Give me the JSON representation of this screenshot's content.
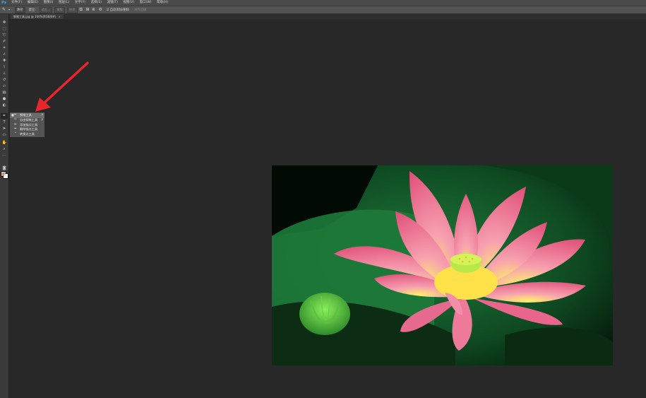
{
  "menubar": {
    "logo": "Ps",
    "items": [
      "文件(F)",
      "编辑(E)",
      "图像(I)",
      "图层(L)",
      "文字(Y)",
      "选择(S)",
      "滤镜(T)",
      "视图(V)",
      "窗口(W)",
      "帮助(H)"
    ]
  },
  "options": {
    "path_mode": "路径",
    "make_label": "建立:",
    "selection_btn": "选区...",
    "mask_btn": "蒙版",
    "shape_btn": "形状",
    "auto_add_delete": "自动添加/删除",
    "align_edges": "对齐边缘"
  },
  "document": {
    "tab_title": "钢笔工具.jpg @ 100%(RGB/8#)"
  },
  "flyout": {
    "items": [
      {
        "label": "钢笔工具",
        "key": "P",
        "selected": true
      },
      {
        "label": "自由钢笔工具",
        "key": "P",
        "selected": false
      },
      {
        "label": "添加锚点工具",
        "key": "",
        "selected": false
      },
      {
        "label": "删除锚点工具",
        "key": "",
        "selected": false
      },
      {
        "label": "转换点工具",
        "key": "",
        "selected": false
      }
    ]
  },
  "colors": {
    "foreground": "#f2a893",
    "background": "#ffffff",
    "annotation_arrow": "#e8262b"
  },
  "icons": {
    "arrow_annotation": "red-arrow-pointing-to-pen-tool"
  }
}
